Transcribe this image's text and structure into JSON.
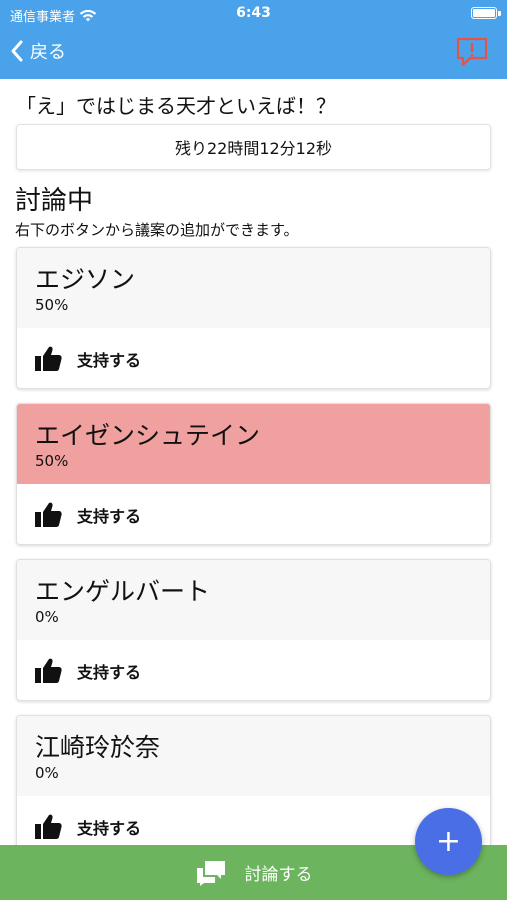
{
  "status_bar": {
    "carrier": "通信事業者",
    "time": "6:43"
  },
  "nav": {
    "back_label": "戻る"
  },
  "question": "「え」ではじまる天才といえば！？",
  "timer_text": "残り22時間12分12秒",
  "section": {
    "title": "討論中",
    "description": "右下のボタンから議案の追加ができます。"
  },
  "proposals": [
    {
      "name": "エジソン",
      "percent": "50%",
      "support_label": "支持する"
    },
    {
      "name": "エイゼンシュテイン",
      "percent": "50%",
      "support_label": "支持する"
    },
    {
      "name": "エンゲルバート",
      "percent": "0%",
      "support_label": "支持する"
    },
    {
      "name": "江崎玲於奈",
      "percent": "0%",
      "support_label": "支持する"
    }
  ],
  "bottom_bar": {
    "label": "討論する"
  },
  "fab": {
    "label": "+"
  },
  "colors": {
    "header": "#4aa3ea",
    "highlight": "#f0a09f",
    "bottom_bar": "#6db45f",
    "fab": "#4a6ee6",
    "report_icon": "#e5534b"
  }
}
